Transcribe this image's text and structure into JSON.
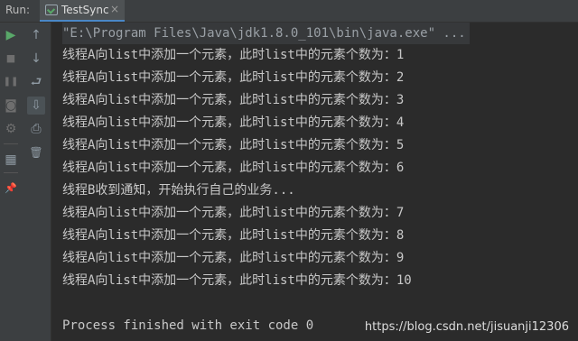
{
  "panel": {
    "run_label": "Run:",
    "tab_title": "TestSync",
    "tab_close": "×"
  },
  "toolbar": {
    "rerun_icon": "▶",
    "up_icon": "↑",
    "stop_icon": "■",
    "down_icon": "↓",
    "pause_icon": "❚❚",
    "wrap_icon": "⮐",
    "camera_icon": "◙",
    "scroll_end_icon": "⇩",
    "settings_icon": "⚙",
    "print_icon": "⎙",
    "trash_icon": "🗑",
    "layout_icon": "▦",
    "pin_icon": "📌"
  },
  "console": {
    "command": "\"E:\\Program Files\\Java\\jdk1.8.0_101\\bin\\java.exe\" ...",
    "lines": [
      "线程A向list中添加一个元素，此时list中的元素个数为：1",
      "线程A向list中添加一个元素，此时list中的元素个数为：2",
      "线程A向list中添加一个元素，此时list中的元素个数为：3",
      "线程A向list中添加一个元素，此时list中的元素个数为：4",
      "线程A向list中添加一个元素，此时list中的元素个数为：5",
      "线程A向list中添加一个元素，此时list中的元素个数为：6",
      "线程B收到通知，开始执行自己的业务...",
      "线程A向list中添加一个元素，此时list中的元素个数为：7",
      "线程A向list中添加一个元素，此时list中的元素个数为：8",
      "线程A向list中添加一个元素，此时list中的元素个数为：9",
      "线程A向list中添加一个元素，此时list中的元素个数为：10"
    ],
    "exit_message": "Process finished with exit code 0"
  },
  "watermark": "https://blog.csdn.net/jisuanji12306"
}
